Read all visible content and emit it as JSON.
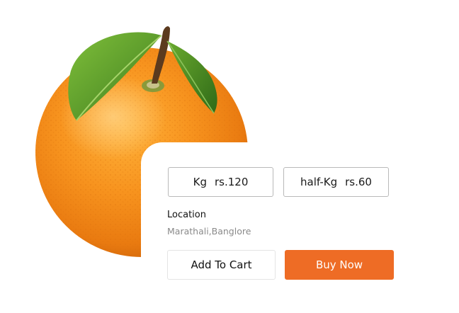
{
  "product": {
    "image_icon": "orange-fruit-icon",
    "options": [
      {
        "unit": "Kg",
        "price": "rs.120"
      },
      {
        "unit": "half-Kg",
        "price": "rs.60"
      }
    ],
    "location": {
      "label": "Location",
      "value": "Marathali,Banglore"
    }
  },
  "actions": {
    "add_to_cart": "Add To Cart",
    "buy_now": "Buy Now"
  },
  "colors": {
    "accent": "#ee6c25",
    "orange_fruit": "#f7931e",
    "leaf": "#5a9a2a"
  }
}
